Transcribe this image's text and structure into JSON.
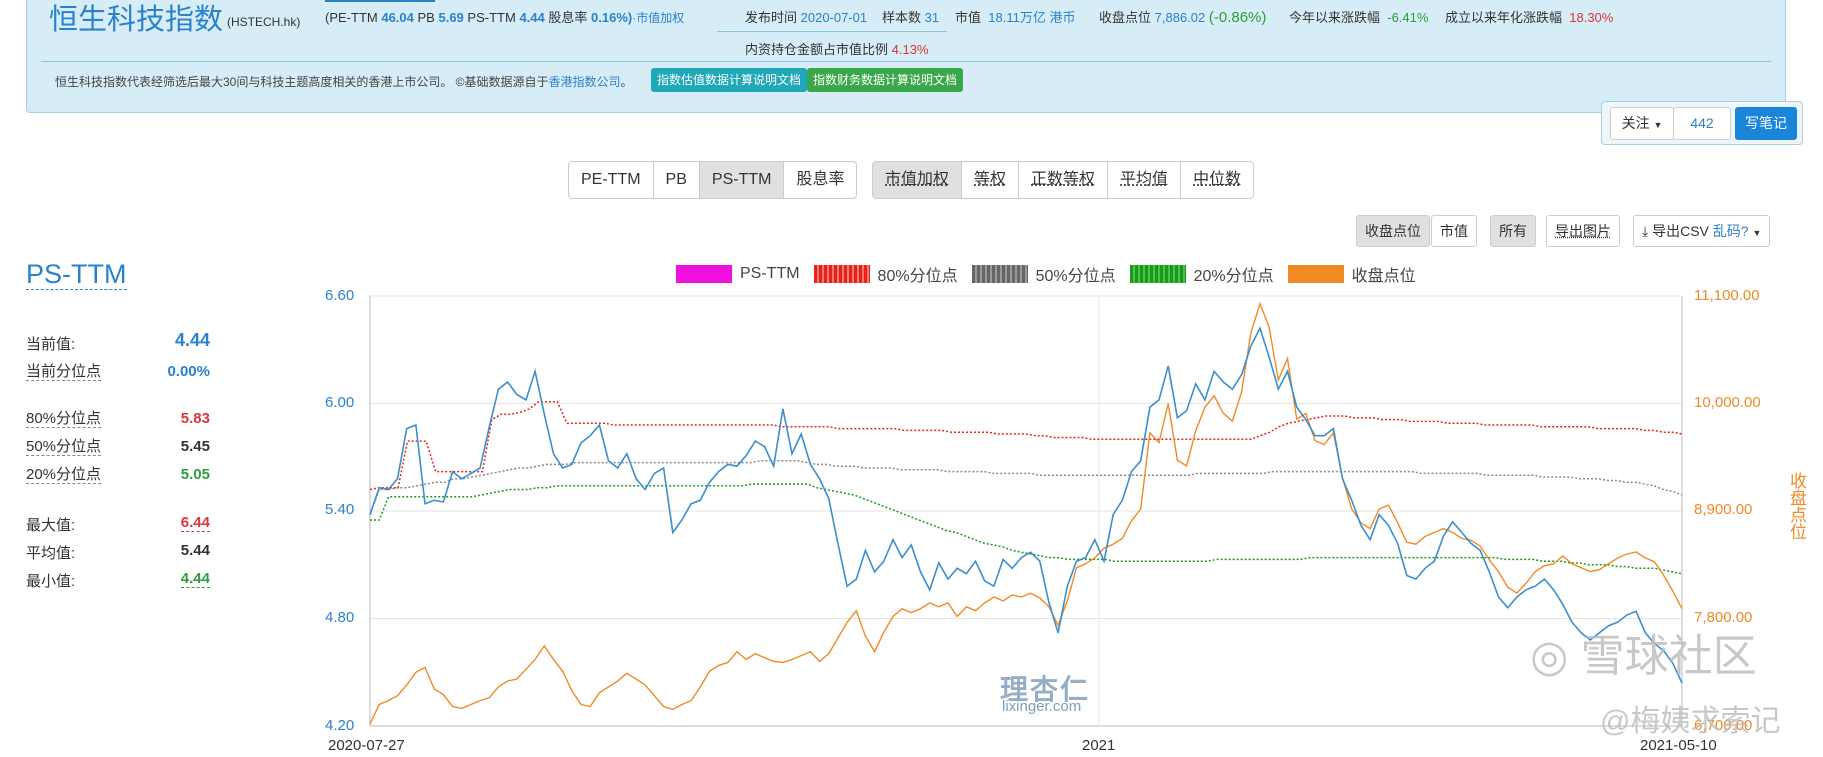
{
  "header": {
    "title": "恒生科技指数",
    "code": "(HSTECH.hk)",
    "metrics_prefix": "(PE-TTM",
    "pe_value": "46.04",
    "pb_label": "PB",
    "pb_value": "5.69",
    "ps_label": "PS-TTM",
    "ps_value": "4.44",
    "div_label": "股息率",
    "div_value": "0.16%)",
    "weighting": "·市值加权",
    "publish_label": "发布时间",
    "publish_value": "2020-07-01",
    "sample_label": "样本数",
    "sample_value": "31",
    "mktcap_label": "市值",
    "mktcap_value": "18.11万亿",
    "mktcap_unit": "港币",
    "close_label": "收盘点位",
    "close_value": "7,886.02",
    "close_change": "(-0.86%)",
    "ytd_label": "今年以来涨跌幅",
    "ytd_value": "-6.41%",
    "annual_label": "成立以来年化涨跌幅",
    "annual_value": "18.30%",
    "inland_label": "内资持仓金额占市值比例",
    "inland_value": "4.13%",
    "description": "恒生科技指数代表经筛选后最大30间与科技主题高度相关的香港上市公司。 ©基础数据源自于",
    "source_link": "香港指数公司",
    "desc_end": "。",
    "btn_valuation_doc": "指数估值数据计算说明文档",
    "btn_finance_doc": "指数财务数据计算说明文档"
  },
  "follow": {
    "follow_label": "关注",
    "follow_count": "442",
    "note_label": "写笔记"
  },
  "metric_tabs": [
    {
      "label": "PE-TTM",
      "active": false
    },
    {
      "label": "PB",
      "active": false
    },
    {
      "label": "PS-TTM",
      "active": true
    },
    {
      "label": "股息率",
      "active": false
    }
  ],
  "weight_tabs": [
    {
      "label": "市值加权",
      "active": true
    },
    {
      "label": "等权",
      "active": false
    },
    {
      "label": "正数等权",
      "active": false
    },
    {
      "label": "平均值",
      "active": false
    },
    {
      "label": "中位数",
      "active": false
    }
  ],
  "secondary": {
    "close_btn": "收盘点位",
    "mktcap_btn": "市值",
    "all_btn": "所有",
    "export_img": "导出图片",
    "export_csv": "导出CSV",
    "garbled": "乱码?"
  },
  "stats": {
    "title": "PS-TTM",
    "current_label": "当前值:",
    "current_value": "4.44",
    "current_pct_label": "当前分位点",
    "current_pct_value": "0.00%",
    "p80_label": "80%分位点",
    "p80_value": "5.83",
    "p50_label": "50%分位点",
    "p50_value": "5.45",
    "p20_label": "20%分位点",
    "p20_value": "5.05",
    "max_label": "最大值:",
    "max_value": "6.44",
    "avg_label": "平均值:",
    "avg_value": "5.44",
    "min_label": "最小值:",
    "min_value": "4.44"
  },
  "colors": {
    "ps": "#ee11dd",
    "p80": "#e8221a",
    "p50": "#666666",
    "p20": "#1a9a1a",
    "close": "#f08a24",
    "ps_line": "#3a8fd0",
    "left_axis": "#2a82cc",
    "right_axis": "#f08a24"
  },
  "watermarks": {
    "lixinger_cn": "理杏仁",
    "lixinger_url": "lixinger.com",
    "xueqiu": "◎ 雪球社区",
    "author": "@梅姨求索记"
  },
  "chart_data": {
    "type": "line",
    "x_labels": [
      "2020-07-27",
      "2021",
      "2021-05-10"
    ],
    "left_axis": {
      "ticks": [
        "6.60",
        "6.00",
        "5.40",
        "4.80",
        "4.20"
      ],
      "range": [
        4.2,
        6.6
      ]
    },
    "right_axis": {
      "label": "收盘点位",
      "ticks": [
        "11,100.00",
        "10,000.00",
        "8,900.00",
        "7,800.00",
        "6,700.00"
      ],
      "range": [
        6700,
        11100
      ]
    },
    "legend": [
      "PS-TTM",
      "80%分位点",
      "50%分位点",
      "20%分位点",
      "收盘点位"
    ],
    "series": [
      {
        "name": "PS-TTM",
        "axis": "left",
        "values": [
          5.38,
          5.53,
          5.52,
          5.58,
          5.86,
          5.88,
          5.44,
          5.46,
          5.45,
          5.62,
          5.58,
          5.61,
          5.64,
          5.87,
          6.08,
          6.12,
          6.05,
          6.02,
          6.18,
          5.94,
          5.72,
          5.64,
          5.66,
          5.78,
          5.82,
          5.88,
          5.68,
          5.64,
          5.72,
          5.58,
          5.52,
          5.61,
          5.64,
          5.28,
          5.35,
          5.44,
          5.46,
          5.56,
          5.62,
          5.66,
          5.65,
          5.71,
          5.79,
          5.76,
          5.65,
          5.97,
          5.72,
          5.83,
          5.66,
          5.58,
          5.47,
          5.22,
          4.98,
          5.02,
          5.18,
          5.06,
          5.12,
          5.24,
          5.14,
          5.21,
          5.06,
          4.96,
          5.11,
          5.02,
          5.08,
          5.05,
          5.12,
          5.01,
          4.98,
          5.13,
          5.08,
          5.14,
          5.17,
          5.12,
          4.89,
          4.72,
          4.98,
          5.12,
          5.14,
          5.24,
          5.12,
          5.38,
          5.46,
          5.62,
          5.68,
          5.98,
          6.02,
          6.21,
          5.92,
          5.96,
          6.11,
          6.02,
          6.18,
          6.12,
          6.08,
          6.16,
          6.32,
          6.42,
          6.26,
          6.08,
          6.18,
          5.98,
          5.91,
          5.82,
          5.82,
          5.86,
          5.58,
          5.46,
          5.32,
          5.24,
          5.38,
          5.32,
          5.22,
          5.04,
          5.02,
          5.08,
          5.12,
          5.26,
          5.34,
          5.28,
          5.22,
          5.18,
          5.06,
          4.92,
          4.86,
          4.92,
          4.96,
          4.98,
          5.02,
          4.96,
          4.88,
          4.78,
          4.72,
          4.68,
          4.72,
          4.76,
          4.78,
          4.82,
          4.84,
          4.72,
          4.66,
          4.62,
          4.55,
          4.44
        ]
      },
      {
        "name": "80%分位点",
        "axis": "left",
        "values": [
          5.52,
          5.53,
          5.53,
          5.53,
          5.79,
          5.79,
          5.79,
          5.62,
          5.62,
          5.62,
          5.62,
          5.62,
          5.62,
          5.91,
          5.94,
          5.94,
          5.95,
          5.97,
          6.01,
          6.01,
          6.01,
          5.89,
          5.89,
          5.89,
          5.89,
          5.89,
          5.88,
          5.88,
          5.88,
          5.88,
          5.88,
          5.88,
          5.88,
          5.88,
          5.88,
          5.88,
          5.88,
          5.88,
          5.88,
          5.88,
          5.88,
          5.88,
          5.88,
          5.88,
          5.87,
          5.87,
          5.87,
          5.87,
          5.87,
          5.87,
          5.86,
          5.86,
          5.86,
          5.86,
          5.86,
          5.86,
          5.86,
          5.85,
          5.85,
          5.85,
          5.85,
          5.85,
          5.84,
          5.84,
          5.84,
          5.84,
          5.84,
          5.83,
          5.83,
          5.83,
          5.83,
          5.82,
          5.82,
          5.81,
          5.81,
          5.81,
          5.81,
          5.8,
          5.8,
          5.8,
          5.8,
          5.8,
          5.8,
          5.8,
          5.8,
          5.8,
          5.8,
          5.8,
          5.8,
          5.8,
          5.8,
          5.8,
          5.8,
          5.8,
          5.8,
          5.82,
          5.84,
          5.87,
          5.89,
          5.9,
          5.91,
          5.92,
          5.93,
          5.93,
          5.93,
          5.92,
          5.92,
          5.92,
          5.91,
          5.91,
          5.91,
          5.9,
          5.9,
          5.9,
          5.9,
          5.89,
          5.89,
          5.89,
          5.89,
          5.88,
          5.88,
          5.88,
          5.88,
          5.88,
          5.88,
          5.87,
          5.87,
          5.87,
          5.87,
          5.87,
          5.87,
          5.86,
          5.86,
          5.86,
          5.86,
          5.86,
          5.85,
          5.85,
          5.84,
          5.84,
          5.83
        ]
      },
      {
        "name": "50%分位点",
        "axis": "left",
        "values": [
          5.38,
          5.52,
          5.52,
          5.53,
          5.53,
          5.54,
          5.55,
          5.56,
          5.56,
          5.58,
          5.58,
          5.59,
          5.6,
          5.61,
          5.62,
          5.63,
          5.64,
          5.64,
          5.65,
          5.66,
          5.66,
          5.66,
          5.67,
          5.67,
          5.67,
          5.67,
          5.67,
          5.67,
          5.67,
          5.67,
          5.67,
          5.67,
          5.67,
          5.67,
          5.67,
          5.67,
          5.67,
          5.67,
          5.67,
          5.67,
          5.67,
          5.67,
          5.68,
          5.68,
          5.68,
          5.68,
          5.68,
          5.67,
          5.66,
          5.66,
          5.65,
          5.65,
          5.65,
          5.64,
          5.64,
          5.64,
          5.64,
          5.63,
          5.63,
          5.63,
          5.63,
          5.63,
          5.62,
          5.62,
          5.62,
          5.62,
          5.62,
          5.61,
          5.61,
          5.61,
          5.61,
          5.61,
          5.6,
          5.6,
          5.6,
          5.6,
          5.6,
          5.6,
          5.6,
          5.6,
          5.6,
          5.6,
          5.6,
          5.6,
          5.6,
          5.6,
          5.6,
          5.6,
          5.6,
          5.61,
          5.61,
          5.61,
          5.61,
          5.61,
          5.61,
          5.61,
          5.61,
          5.62,
          5.62,
          5.62,
          5.62,
          5.62,
          5.62,
          5.62,
          5.62,
          5.62,
          5.62,
          5.62,
          5.62,
          5.62,
          5.62,
          5.62,
          5.62,
          5.61,
          5.61,
          5.61,
          5.61,
          5.61,
          5.61,
          5.61,
          5.6,
          5.6,
          5.6,
          5.6,
          5.6,
          5.6,
          5.59,
          5.59,
          5.59,
          5.59,
          5.58,
          5.58,
          5.58,
          5.57,
          5.57,
          5.56,
          5.56,
          5.55,
          5.54,
          5.52,
          5.51,
          5.49
        ]
      },
      {
        "name": "20%分位点",
        "axis": "left",
        "values": [
          5.35,
          5.35,
          5.48,
          5.48,
          5.48,
          5.48,
          5.48,
          5.48,
          5.48,
          5.48,
          5.48,
          5.48,
          5.49,
          5.5,
          5.51,
          5.52,
          5.52,
          5.52,
          5.53,
          5.53,
          5.54,
          5.54,
          5.54,
          5.54,
          5.54,
          5.54,
          5.54,
          5.54,
          5.54,
          5.54,
          5.54,
          5.54,
          5.54,
          5.54,
          5.54,
          5.54,
          5.54,
          5.54,
          5.54,
          5.54,
          5.54,
          5.55,
          5.55,
          5.55,
          5.55,
          5.55,
          5.55,
          5.55,
          5.53,
          5.52,
          5.51,
          5.5,
          5.49,
          5.47,
          5.45,
          5.43,
          5.41,
          5.39,
          5.37,
          5.35,
          5.33,
          5.31,
          5.29,
          5.28,
          5.26,
          5.24,
          5.22,
          5.21,
          5.2,
          5.18,
          5.17,
          5.16,
          5.15,
          5.14,
          5.14,
          5.13,
          5.13,
          5.13,
          5.13,
          5.13,
          5.12,
          5.12,
          5.12,
          5.12,
          5.12,
          5.12,
          5.12,
          5.12,
          5.12,
          5.12,
          5.12,
          5.13,
          5.13,
          5.13,
          5.13,
          5.13,
          5.13,
          5.13,
          5.13,
          5.13,
          5.13,
          5.14,
          5.14,
          5.14,
          5.14,
          5.14,
          5.14,
          5.14,
          5.14,
          5.14,
          5.14,
          5.14,
          5.14,
          5.14,
          5.14,
          5.14,
          5.14,
          5.14,
          5.14,
          5.14,
          5.14,
          5.14,
          5.13,
          5.13,
          5.13,
          5.13,
          5.12,
          5.12,
          5.12,
          5.11,
          5.11,
          5.1,
          5.1,
          5.1,
          5.09,
          5.09,
          5.08,
          5.08,
          5.08,
          5.07,
          5.06,
          5.05
        ]
      },
      {
        "name": "收盘点位",
        "axis": "right",
        "values": [
          6720,
          6920,
          6960,
          7010,
          7120,
          7250,
          7300,
          7080,
          7020,
          6900,
          6880,
          6920,
          6960,
          6990,
          7100,
          7160,
          7180,
          7280,
          7380,
          7520,
          7380,
          7260,
          7060,
          6920,
          6900,
          7040,
          7100,
          7160,
          7240,
          7180,
          7120,
          7010,
          6900,
          6870,
          6920,
          6960,
          7100,
          7260,
          7320,
          7350,
          7460,
          7380,
          7440,
          7400,
          7360,
          7350,
          7380,
          7420,
          7460,
          7360,
          7440,
          7600,
          7760,
          7880,
          7620,
          7460,
          7660,
          7820,
          7900,
          7860,
          7900,
          7960,
          7920,
          7960,
          7820,
          7920,
          7880,
          7960,
          8020,
          7980,
          8040,
          8020,
          8060,
          8010,
          7920,
          7730,
          7980,
          8320,
          8360,
          8420,
          8520,
          8560,
          8620,
          8800,
          8920,
          9700,
          9600,
          10000,
          9420,
          9360,
          9720,
          9960,
          10080,
          9900,
          9820,
          10120,
          10720,
          11020,
          10780,
          10240,
          10460,
          9840,
          9900,
          9620,
          9580,
          9700,
          9240,
          8920,
          8780,
          8720,
          8920,
          8960,
          8780,
          8580,
          8560,
          8640,
          8680,
          8720,
          8680,
          8620,
          8600,
          8540,
          8400,
          8280,
          8120,
          8060,
          8160,
          8280,
          8340,
          8360,
          8440,
          8360,
          8320,
          8280,
          8300,
          8360,
          8420,
          8460,
          8480,
          8420,
          8380,
          8240,
          8080,
          7900
        ]
      }
    ]
  }
}
